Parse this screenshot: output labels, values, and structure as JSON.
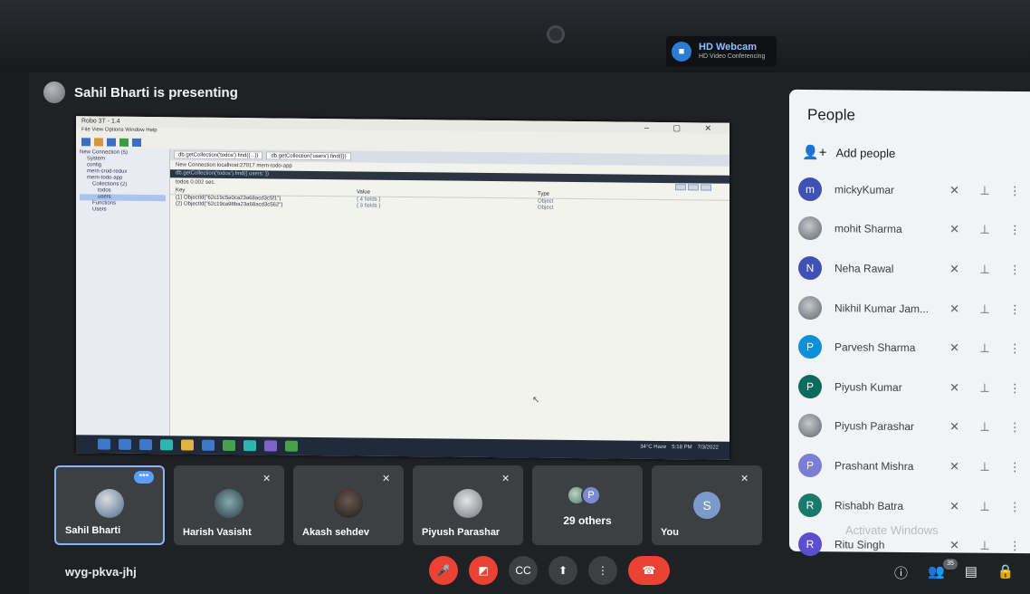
{
  "webcam": {
    "title": "HD Webcam",
    "subtitle": "HD Video Conferencing"
  },
  "presenter": {
    "text": "Sahil Bharti is presenting"
  },
  "shared_screen": {
    "window_title": "Robo 3T - 1.4",
    "menu": "File   View   Options   Window   Help",
    "tree": [
      "New Connection (5)",
      "System",
      "config",
      "mern-crud-redux",
      "mern-todo-app",
      "Collections (2)",
      "todos",
      "users",
      "Functions",
      "Users"
    ],
    "tabs": [
      "db.getCollection('todos').find({...})",
      "db.getCollection('users').find({})"
    ],
    "connection": "New Connection    localhost:27017    mern-todo-app",
    "query": "db.getCollection('todos').find({ users: })",
    "result_header": "todos   0.002 sec.",
    "pager": [
      "0",
      "50"
    ],
    "columns": [
      "Key",
      "Value",
      "Type"
    ],
    "rows": [
      {
        "key": "(1) ObjectId(\"62c19c5e0ca23a68acd3c5f1\")",
        "value": "{ 4 fields }",
        "type": "Object"
      },
      {
        "key": "(2) ObjectId(\"62c19ca98ba23a68acd3c562\")",
        "value": "{ 3 fields }",
        "type": "Object"
      }
    ],
    "tray": [
      "34°C  Haze",
      "5:18 PM",
      "7/3/2022"
    ]
  },
  "tiles": [
    {
      "name": "Sahil Bharti",
      "menu": "•••"
    },
    {
      "name": "Harish Vasisht"
    },
    {
      "name": "Akash sehdev"
    },
    {
      "name": "Piyush Parashar"
    },
    {
      "others": "29 others",
      "avatar_letter": "P"
    },
    {
      "name": "You",
      "avatar_letter": "S"
    }
  ],
  "people": {
    "title": "People",
    "add": "Add people",
    "list": [
      {
        "name": "mickyKumar",
        "letter": "m",
        "color": "#3f51b5"
      },
      {
        "name": "mohit Sharma",
        "letter": "",
        "color": "#8a8f96"
      },
      {
        "name": "Neha Rawal",
        "letter": "N",
        "color": "#3f51b5"
      },
      {
        "name": "Nikhil Kumar Jam...",
        "letter": "",
        "color": "#8a8f96"
      },
      {
        "name": "Parvesh Sharma",
        "letter": "P",
        "color": "#0d8fd9"
      },
      {
        "name": "Piyush Kumar",
        "letter": "P",
        "color": "#0b6b5e"
      },
      {
        "name": "Piyush Parashar",
        "letter": "",
        "color": "#8a8f96"
      },
      {
        "name": "Prashant Mishra",
        "letter": "P",
        "color": "#7b7fd3"
      },
      {
        "name": "Rishabh Batra",
        "letter": "R",
        "color": "#197a6c"
      },
      {
        "name": "Ritu Singh",
        "letter": "R",
        "color": "#5b4fcf"
      }
    ]
  },
  "meeting_code": "wyg-pkva-jhj",
  "participant_count": "35",
  "watermark": "Activate Windows"
}
